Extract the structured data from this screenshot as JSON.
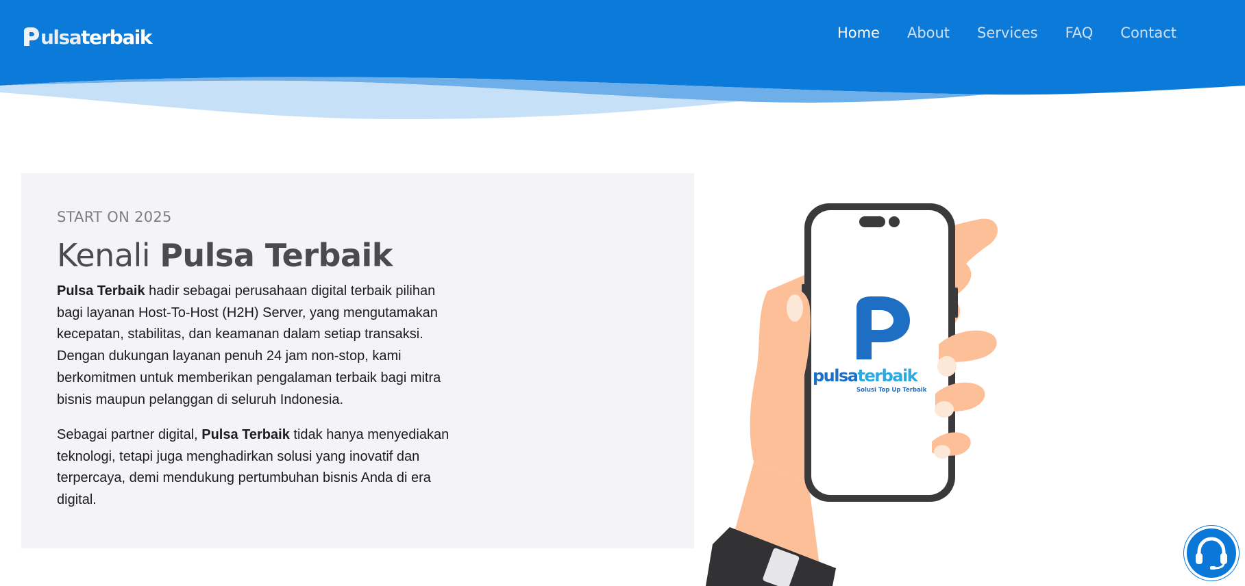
{
  "colors": {
    "brand_blue": "#0b7ad8",
    "wave_light": "#c6e0f7",
    "wave_mid": "#6eaee9",
    "card_bg": "#f4f4f6",
    "text_dark": "#1c1c1f",
    "nav_inactive": "#cfe1f7",
    "nav_active": "#ffffff"
  },
  "header": {
    "logo": {
      "initial": "P",
      "part1": "ulsa",
      "part2": "terbaik"
    },
    "nav": {
      "items": [
        {
          "label": "Home",
          "active": true
        },
        {
          "label": "About",
          "active": false
        },
        {
          "label": "Services",
          "active": false
        },
        {
          "label": "FAQ",
          "active": false
        },
        {
          "label": "Contact",
          "active": false
        }
      ]
    }
  },
  "about": {
    "eyebrow": "START ON 2025",
    "title_light": "Kenali ",
    "title_bold": "Pulsa Terbaik",
    "para1_bold": "Pulsa Terbaik",
    "para1_rest": " hadir sebagai perusahaan digital terbaik pilihan bagi layanan Host-To-Host (H2H) Server, yang mengutamakan kecepatan, stabilitas, dan keamanan dalam setiap transaksi. Dengan dukungan layanan penuh 24 jam non-stop, kami berkomitmen untuk memberikan pengalaman terbaik bagi mitra bisnis maupun pelanggan di seluruh Indonesia.",
    "para2_pre": "Sebagai partner digital, ",
    "para2_bold": "Pulsa Terbaik",
    "para2_rest": " tidak hanya menyediakan teknologi, tetapi juga menghadirkan solusi yang inovatif dan terpercaya, demi mendukung pertumbuhan bisnis Anda di era digital."
  },
  "phone_screen": {
    "brand_dark": "pulsa",
    "brand_light": "terbaik",
    "tagline": "Solusi Top Up Terbaik"
  },
  "support": {
    "icon": "headset-icon"
  }
}
